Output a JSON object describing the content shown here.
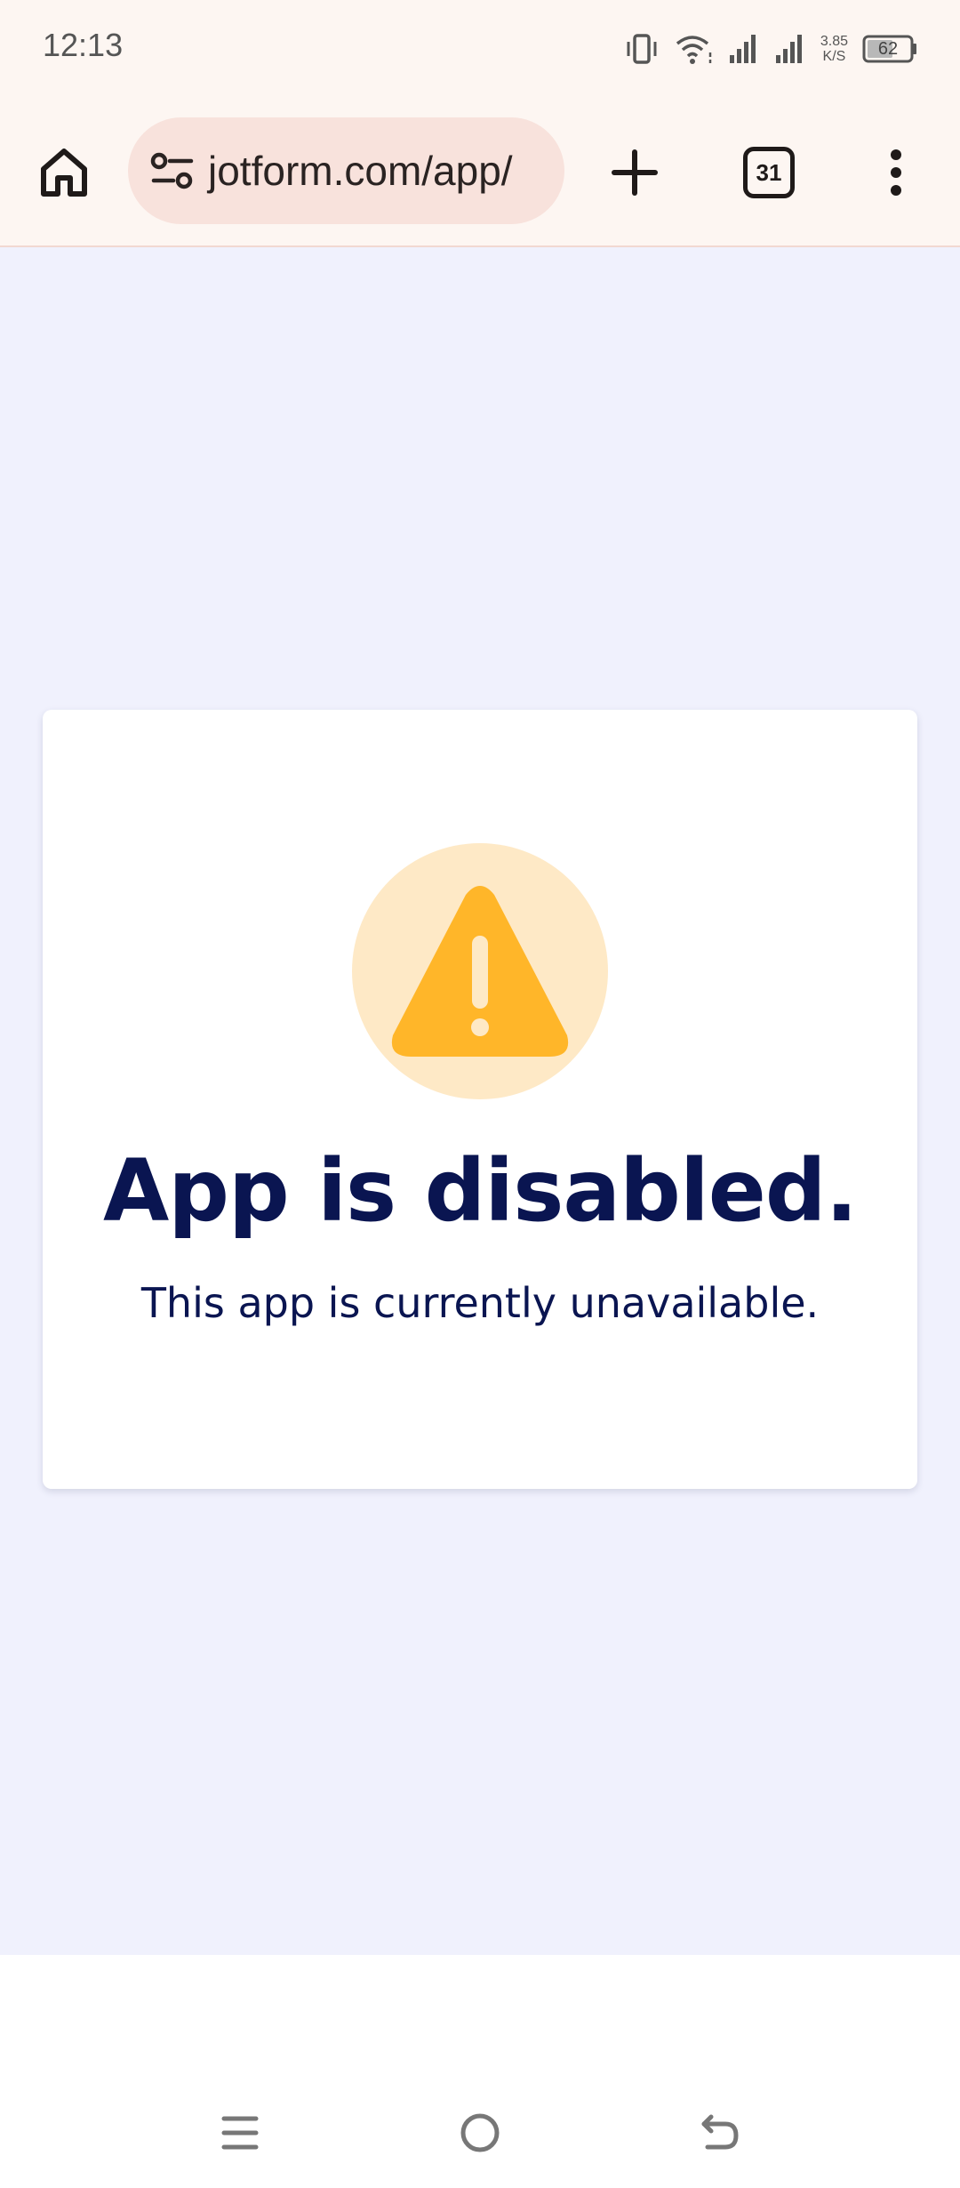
{
  "status_bar": {
    "time": "12:13",
    "net_speed_value": "3.85",
    "net_speed_unit": "K/S",
    "battery": "62",
    "icons": [
      "vibrate-icon",
      "wifi-icon",
      "signal-icon",
      "signal-icon"
    ]
  },
  "browser": {
    "url": "jotform.com/app/",
    "tab_count": "31",
    "icons": [
      "home-icon",
      "site-settings-icon",
      "plus-icon",
      "more-vertical-icon"
    ]
  },
  "card": {
    "icon": "warning-icon",
    "title": "App is disabled.",
    "message": "This app is currently unavailable."
  },
  "navigation": {
    "icons": [
      "recent-apps-icon",
      "home-circle-icon",
      "back-icon"
    ]
  },
  "colors": {
    "page_background": "#f0f1fd",
    "text_primary": "#0a1551",
    "warning": "#ffb629",
    "warning_bg": "#fee9c6",
    "browser_bar": "#fdf6f2",
    "url_pill": "#f8e2dc"
  }
}
